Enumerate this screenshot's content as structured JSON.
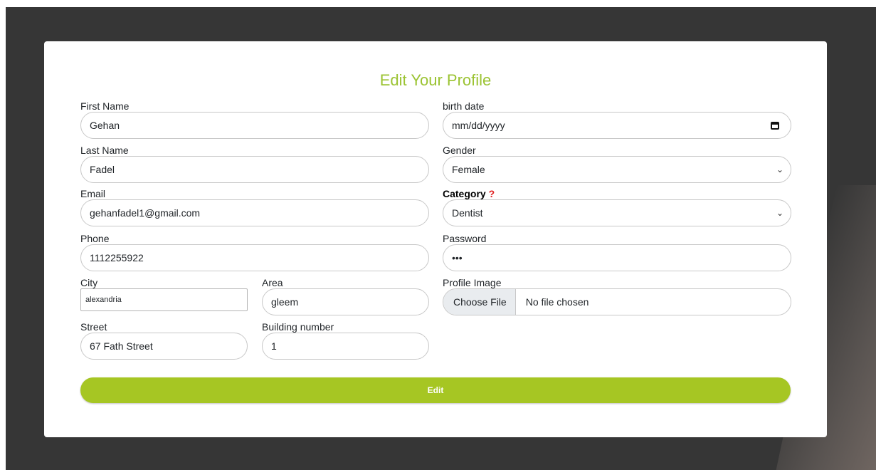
{
  "form": {
    "title": "Edit Your Profile",
    "first_name": {
      "label": "First Name",
      "value": "Gehan"
    },
    "last_name": {
      "label": "Last Name",
      "value": "Fadel"
    },
    "email": {
      "label": "Email",
      "value": "gehanfadel1@gmail.com"
    },
    "phone": {
      "label": "Phone",
      "value": "1112255922"
    },
    "city": {
      "label": "City",
      "value": "alexandria"
    },
    "area": {
      "label": "Area",
      "value": "gleem"
    },
    "street": {
      "label": "Street",
      "value": "67 Fath Street"
    },
    "building": {
      "label": "Building number",
      "value": "1"
    },
    "birth_date": {
      "label": "birth date",
      "value": "mm/dd/yyyy"
    },
    "gender": {
      "label": "Gender",
      "value": "Female"
    },
    "category": {
      "label": "Category",
      "required_mark": "?",
      "value": "Dentist"
    },
    "password": {
      "label": "Password",
      "value": "•••"
    },
    "profile_image": {
      "label": "Profile Image",
      "button": "Choose File",
      "status": "No file chosen"
    },
    "submit_label": "Edit"
  },
  "colors": {
    "accent": "#a6c623",
    "title": "#9bc332",
    "backdrop": "#363636"
  },
  "icons": {
    "calendar": "calendar-icon",
    "dropdown": "chevron-down-icon"
  }
}
